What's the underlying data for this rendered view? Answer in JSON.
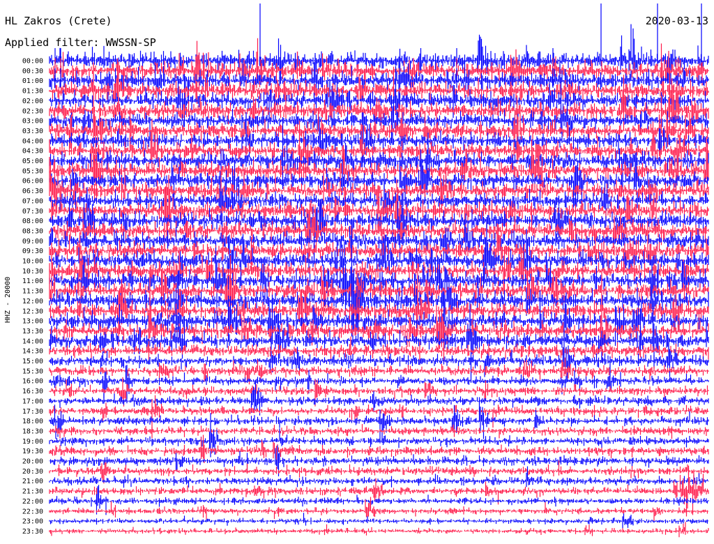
{
  "header": {
    "station": "HL Zakros (Crete)",
    "date": "2020-03-13",
    "filter": "Applied filter: WWSSN-SP"
  },
  "chart_data": {
    "type": "line",
    "title": "HL Zakros (Crete)",
    "date": "2020-03-13",
    "filter": "WWSSN-SP",
    "channel_label": "HHZ - 20000",
    "trace_colors": [
      "#0000ff",
      "#ff1a4a"
    ],
    "row_labels": [
      "00:00",
      "00:30",
      "01:00",
      "01:30",
      "02:00",
      "02:30",
      "03:00",
      "03:30",
      "04:00",
      "04:30",
      "05:00",
      "05:30",
      "06:00",
      "06:30",
      "07:00",
      "07:30",
      "08:00",
      "08:30",
      "09:00",
      "09:30",
      "10:00",
      "10:30",
      "11:00",
      "11:30",
      "12:00",
      "12:30",
      "13:00",
      "13:30",
      "14:00",
      "14:30",
      "15:00",
      "15:30",
      "16:00",
      "16:30",
      "17:00",
      "17:30",
      "18:00",
      "18:30",
      "19:00",
      "19:30",
      "20:00",
      "20:30",
      "21:00",
      "21:30",
      "22:00",
      "22:30",
      "23:00",
      "23:30"
    ],
    "relative_activity": [
      1.0,
      1.0,
      1.0,
      0.95,
      0.95,
      0.95,
      0.9,
      0.9,
      0.9,
      0.9,
      0.95,
      0.95,
      0.95,
      0.95,
      0.95,
      0.95,
      0.95,
      0.95,
      0.95,
      0.95,
      0.95,
      0.95,
      0.95,
      0.95,
      0.95,
      0.95,
      0.95,
      0.9,
      0.85,
      0.7,
      0.6,
      0.5,
      0.45,
      0.42,
      0.42,
      0.4,
      0.42,
      0.4,
      0.42,
      0.42,
      0.42,
      0.4,
      0.38,
      0.35,
      0.3,
      0.25,
      0.2,
      0.18
    ]
  }
}
